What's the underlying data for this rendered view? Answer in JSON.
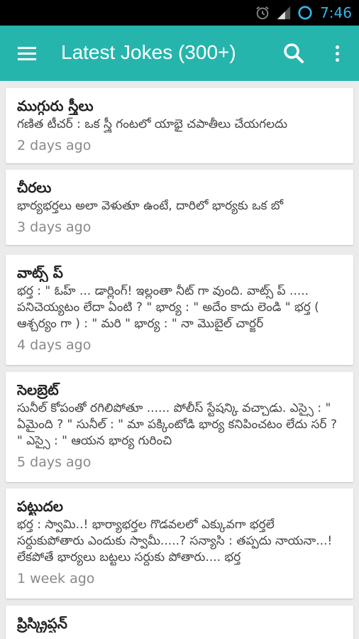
{
  "status_bar": {
    "time": "7:46",
    "icons": [
      "alarm-icon",
      "signal-icon",
      "sync-icon"
    ]
  },
  "app_bar": {
    "title": "Latest Jokes (300+)",
    "color": "#26b5ad",
    "icons": [
      "menu-icon",
      "search-icon",
      "more-vert-icon"
    ]
  },
  "jokes": [
    {
      "title": "ముగ్గురు స్త్రీలు",
      "body": "గణిత టీచర్ : ఒక స్త్రీ గంటలో యాభై చపాతీలు చేయగలదు",
      "time": "2 days ago"
    },
    {
      "title": "చీరలు",
      "body": "భార్యభర్తలు అలా వెళుతూ ఉంటే, దారిలో భార్యకు ఒక బో",
      "time": "3 days ago"
    },
    {
      "title": "వాట్స్ ప్",
      "body": "భర్త : \" ఓహ్ ... డార్లింగ్! ఇల్లంతా నీట్ గా వుంది. వాట్స్ ప్ ..... పనిచెయ్యటం లేదా ఏంటి ? \" భార్య : \" అదేం కాదు లెండి \" భర్త ( ఆశ్చర్యం గా ) : \" మరి \" భార్య : \" నా మొబైల్ చార్జర్",
      "time": "4 days ago"
    },
    {
      "title": "సెలబ్రెట్",
      "body": "సునీల్ కోపంతో రగిలిపోతూ ...... పోలీస్ స్టేషన్కి వచ్చాడు. ఎస్సై : \" ఏమైంది ? \" సునీల్ : \" మా పక్కింటోడి భార్య కనిపించటం లేదు సర్ ? \" ఎస్సై : \" ఆయన భార్య గురించి",
      "time": "5 days ago"
    },
    {
      "title": "పట్టుదల",
      "body": "భర్త : స్వామి..! భార్యాభర్తల గొడవలలో ఎక్కువగా భర్తలే సర్దుకుపోతారు ఎందుకు స్వామీ.....? సన్యాసి : తప్పదు నాయనా...! లేకపోతే భార్యలు బట్టలు సర్దుకు పోతారు.... భర్త",
      "time": "1 week ago"
    },
    {
      "title": "ప్రిస్క్రిప్షన్",
      "body": "",
      "time": ""
    }
  ]
}
